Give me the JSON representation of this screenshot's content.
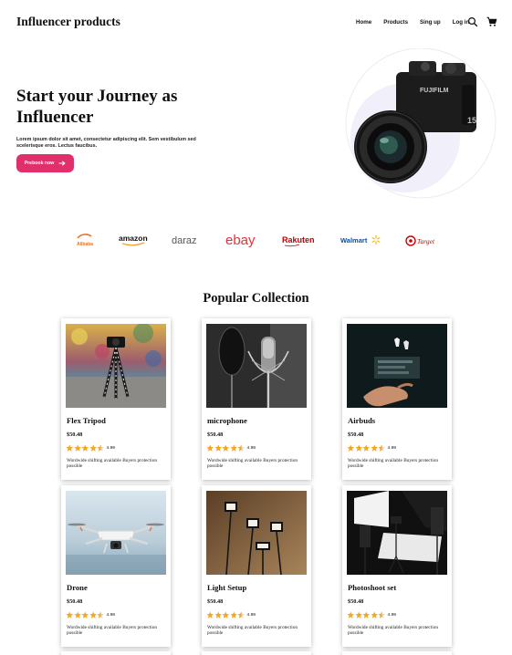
{
  "header": {
    "brand": "Influencer products",
    "nav": [
      "Home",
      "Products",
      "Sing up",
      "Log in"
    ],
    "search_icon": "search-icon",
    "cart_icon": "cart-icon"
  },
  "hero": {
    "title": "Start your Journey as Influencer",
    "text": "Lorem ipsum dolor sit amet, consectetur adipiscing elit. Sem vestibulum sed scelerisque eros. Lectus faucibus.",
    "cta_label": "Prebook now",
    "cta_icon": "arrow-right-icon",
    "accent": "#e02f6b",
    "image": "mirrorless-camera"
  },
  "brands": [
    "Alibaba",
    "amazon",
    "daraz",
    "ebay",
    "Rakuten",
    "Walmart",
    "Target"
  ],
  "collection": {
    "title": "Popular Collection",
    "products": [
      {
        "name": "Flex Tripod",
        "price": "$50.48",
        "rating": "4.99",
        "stars": 4.5,
        "shipping": "Wordwide shifting available Buyers protection possible",
        "image": "tripod"
      },
      {
        "name": "microphone",
        "price": "$50.48",
        "rating": "4.99",
        "stars": 4.5,
        "shipping": "Wordwide shifting available Buyers protection possible",
        "image": "microphone"
      },
      {
        "name": "Airbuds",
        "price": "$50.48",
        "rating": "4.99",
        "stars": 4.5,
        "shipping": "Wordwide shifting available Buyers protection possible",
        "image": "airbuds"
      },
      {
        "name": "Drone",
        "price": "$50.48",
        "rating": "4.99",
        "stars": 4.5,
        "shipping": "Wordwide shifting available Buyers protection possible",
        "image": "drone"
      },
      {
        "name": "Light Setup",
        "price": "$50.48",
        "rating": "4.99",
        "stars": 4.5,
        "shipping": "Wordwide shifting available Buyers protection possible",
        "image": "light-setup"
      },
      {
        "name": "Photoshoot set",
        "price": "$50.48",
        "rating": "4.99",
        "stars": 4.5,
        "shipping": "Wordwide shifting available Buyers protection possible",
        "image": "photoshoot-set"
      }
    ],
    "star_color": "#f5a623"
  }
}
